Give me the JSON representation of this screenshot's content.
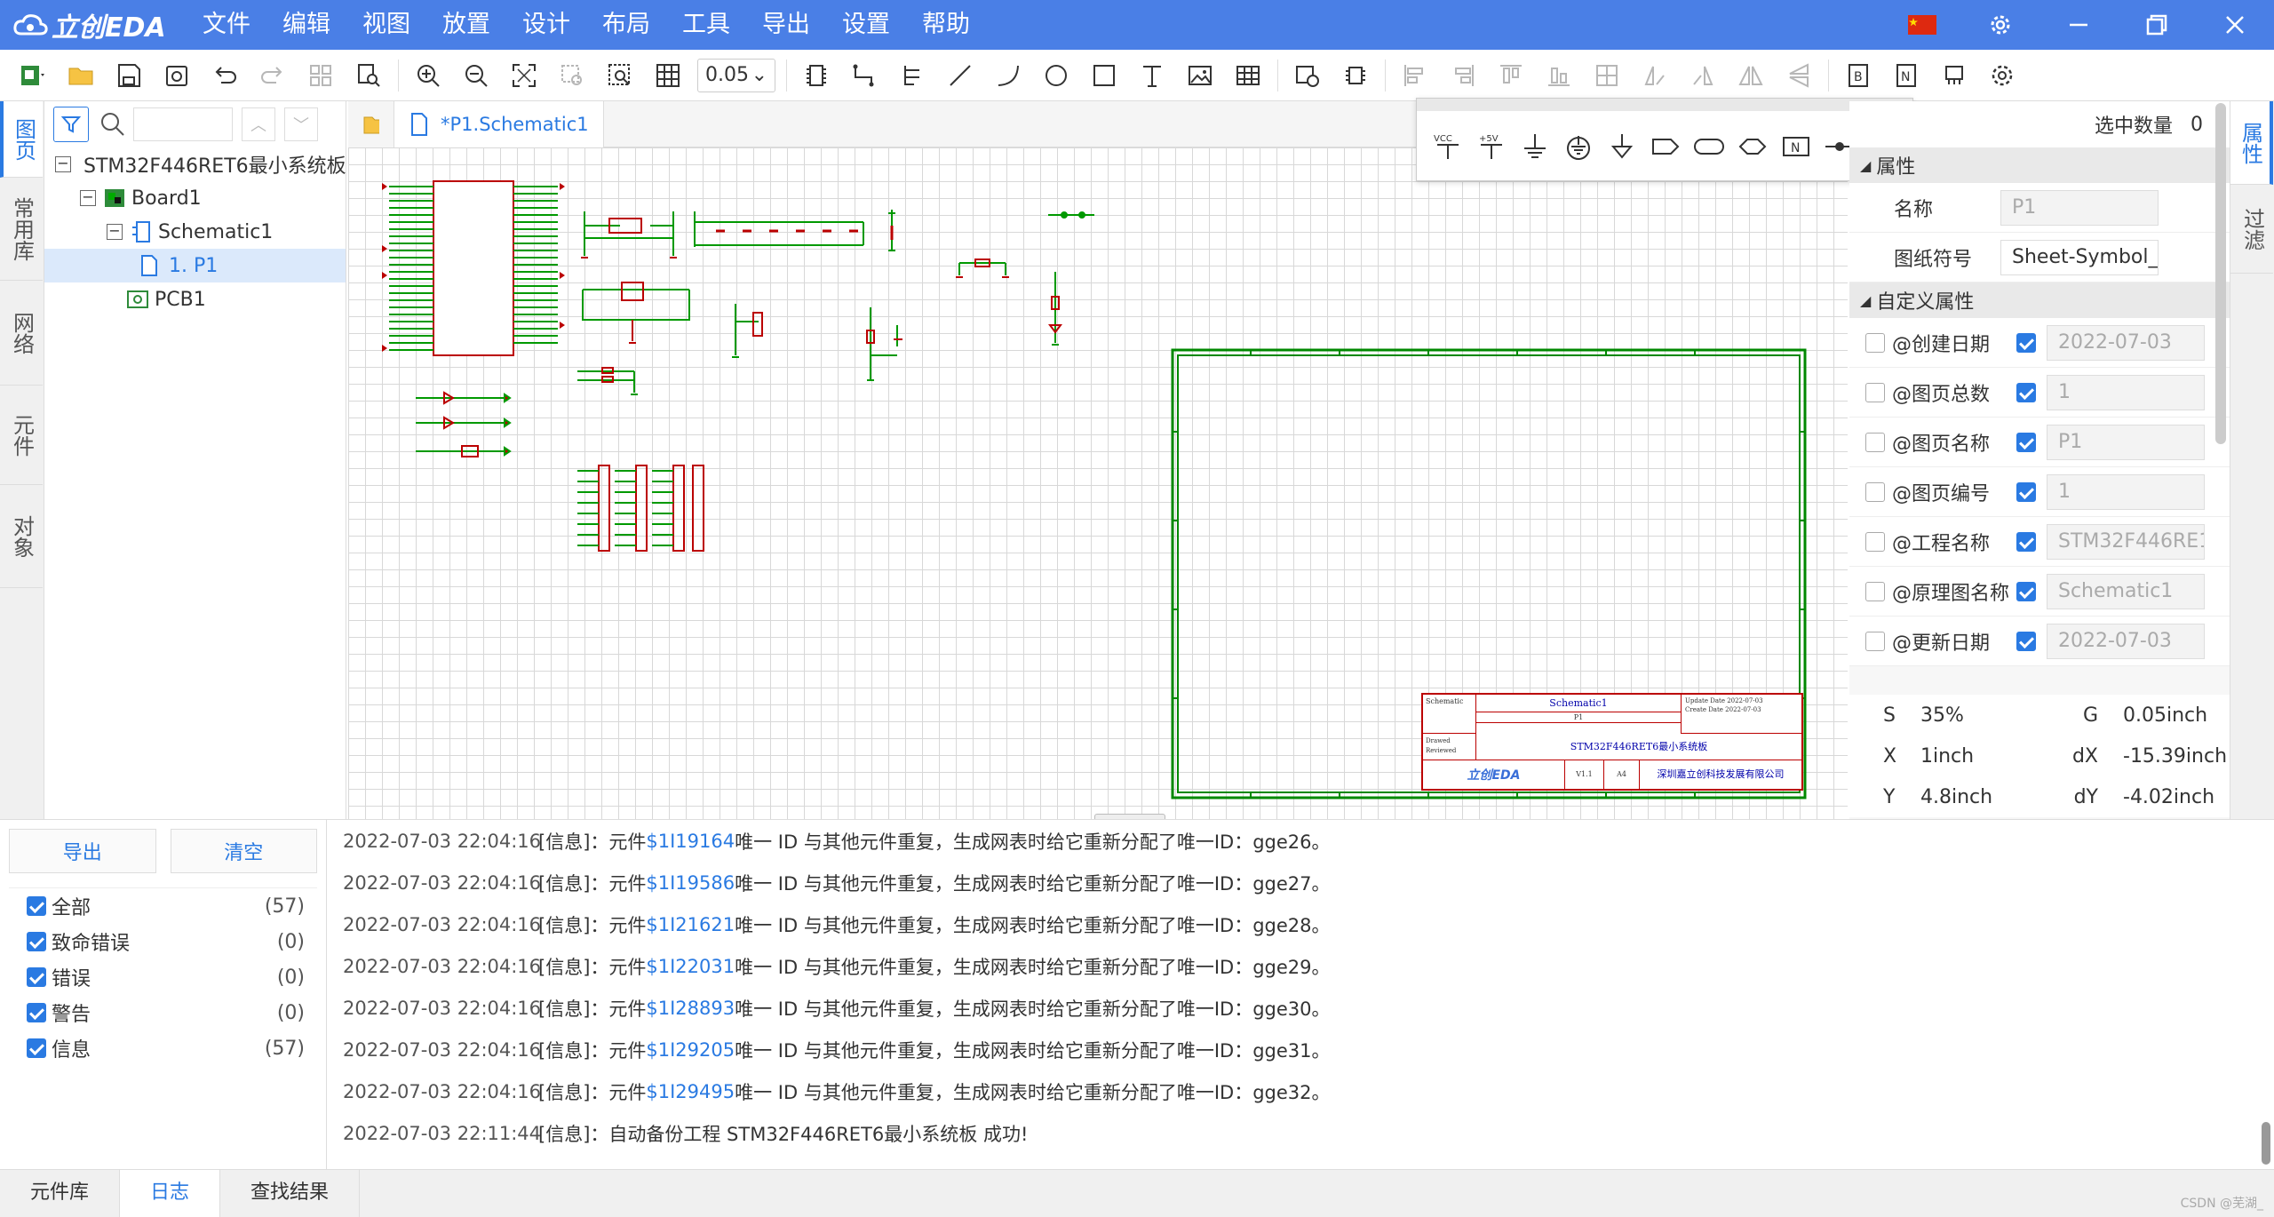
{
  "app": {
    "logo_text": "立创EDA",
    "menu": [
      "文件",
      "编辑",
      "视图",
      "放置",
      "设计",
      "布局",
      "工具",
      "导出",
      "设置",
      "帮助"
    ]
  },
  "toolbar": {
    "zoom": "0.05"
  },
  "left_tabs": [
    "图页",
    "常用库",
    "网络",
    "元件",
    "对象"
  ],
  "tree": {
    "items": [
      {
        "label": "STM32F446RET6最小系统板",
        "level": 0
      },
      {
        "label": "Board1",
        "level": 1
      },
      {
        "label": "Schematic1",
        "level": 2
      },
      {
        "label": "1. P1",
        "level": 3
      },
      {
        "label": "PCB1",
        "level": 1
      }
    ]
  },
  "doc_tab": "*P1.Schematic1",
  "palette": [
    "VCC",
    "+5V",
    "GND",
    "earth",
    "ground-arrow",
    "net-port",
    "net-label-in",
    "net-label-bi",
    "no-connect-flag",
    "bus-entry",
    "close"
  ],
  "title_block": {
    "sheet_name": "Schematic1",
    "project": "STM32F446RET6最小系统板",
    "company": "深圳嘉立创科技发展有限公司",
    "update_date": "2022-07-03",
    "create_date": "2022-07-03",
    "page": "P1",
    "ver": "V1.1",
    "size": "A4",
    "logo": "立创EDA"
  },
  "properties": {
    "selected_count_label": "选中数量",
    "selected_count": "0",
    "basic_header": "属性",
    "name_label": "名称",
    "name_value": "P1",
    "symbol_label": "图纸符号",
    "symbol_value": "Sheet-Symbol_",
    "custom_header": "自定义属性",
    "custom": [
      {
        "name": "@创建日期",
        "value": "2022-07-03"
      },
      {
        "name": "@图页总数",
        "value": "1"
      },
      {
        "name": "@图页名称",
        "value": "P1"
      },
      {
        "name": "@图页编号",
        "value": "1"
      },
      {
        "name": "@工程名称",
        "value": "STM32F446RE1"
      },
      {
        "name": "@原理图名称",
        "value": "Schematic1"
      },
      {
        "name": "@更新日期",
        "value": "2022-07-03"
      }
    ],
    "stats": {
      "s_label": "S",
      "s": "35%",
      "g_label": "G",
      "g": "0.05inch",
      "x_label": "X",
      "x": "1inch",
      "dx_label": "dX",
      "dx": "-15.39inch",
      "y_label": "Y",
      "y": "4.8inch",
      "dy_label": "dY",
      "dy": "-4.02inch"
    }
  },
  "right_tabs": [
    "属性",
    "过滤"
  ],
  "log": {
    "export_label": "导出",
    "clear_label": "清空",
    "filters": [
      {
        "label": "全部",
        "count": "(57)"
      },
      {
        "label": "致命错误",
        "count": "(0)"
      },
      {
        "label": "错误",
        "count": "(0)"
      },
      {
        "label": "警告",
        "count": "(0)"
      },
      {
        "label": "信息",
        "count": "(57)"
      }
    ],
    "entries": [
      {
        "time": "2022-07-03 22:04:16",
        "pre": "[信息]：元件 ",
        "link": "$1I19164",
        "post": " 唯一 ID 与其他元件重复，生成网表时给它重新分配了唯一ID：gge26。"
      },
      {
        "time": "2022-07-03 22:04:16",
        "pre": "[信息]：元件 ",
        "link": "$1I19586",
        "post": " 唯一 ID 与其他元件重复，生成网表时给它重新分配了唯一ID：gge27。"
      },
      {
        "time": "2022-07-03 22:04:16",
        "pre": "[信息]：元件 ",
        "link": "$1I21621",
        "post": " 唯一 ID 与其他元件重复，生成网表时给它重新分配了唯一ID：gge28。"
      },
      {
        "time": "2022-07-03 22:04:16",
        "pre": "[信息]：元件 ",
        "link": "$1I22031",
        "post": " 唯一 ID 与其他元件重复，生成网表时给它重新分配了唯一ID：gge29。"
      },
      {
        "time": "2022-07-03 22:04:16",
        "pre": "[信息]：元件 ",
        "link": "$1I28893",
        "post": " 唯一 ID 与其他元件重复，生成网表时给它重新分配了唯一ID：gge30。"
      },
      {
        "time": "2022-07-03 22:04:16",
        "pre": "[信息]：元件 ",
        "link": "$1I29205",
        "post": " 唯一 ID 与其他元件重复，生成网表时给它重新分配了唯一ID：gge31。"
      },
      {
        "time": "2022-07-03 22:04:16",
        "pre": "[信息]：元件 ",
        "link": "$1I29495",
        "post": " 唯一 ID 与其他元件重复，生成网表时给它重新分配了唯一ID：gge32。"
      },
      {
        "time": "2022-07-03 22:11:44",
        "pre": "[信息]：自动备份工程 STM32F446RET6最小系统板 成功!",
        "link": "",
        "post": ""
      }
    ]
  },
  "bottom_tabs": [
    "元件库",
    "日志",
    "查找结果"
  ],
  "watermark": "CSDN @芜湖_"
}
